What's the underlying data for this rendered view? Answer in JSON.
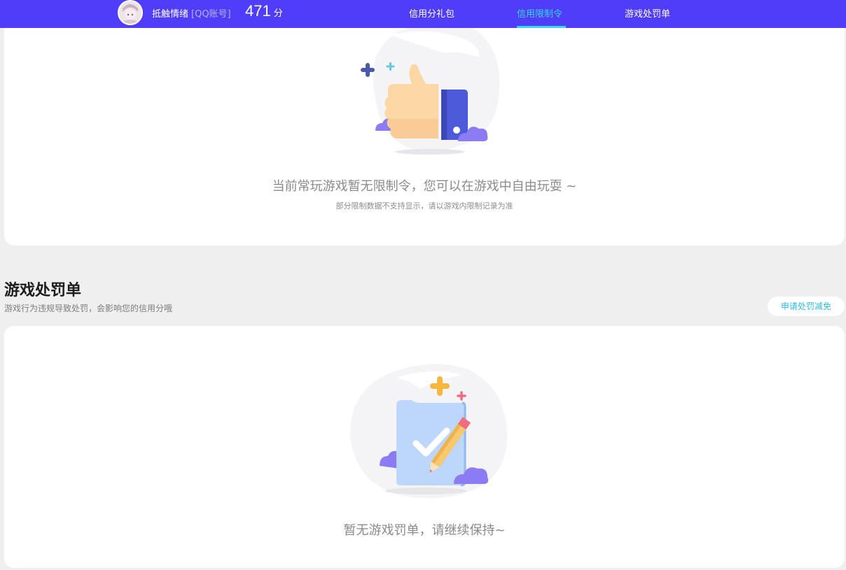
{
  "header": {
    "username": "抵触情绪",
    "account_tag": "[QQ账号]",
    "score": "471",
    "score_unit": "分",
    "nav": [
      {
        "label": "信用分礼包",
        "active": false
      },
      {
        "label": "信用限制令",
        "active": true
      },
      {
        "label": "游戏处罚单",
        "active": false
      }
    ]
  },
  "restriction_card": {
    "icon": "thumbs-up-illustration",
    "message": "当前常玩游戏暂无限制令，您可以在游戏中自由玩耍 ~",
    "note": "部分限制数据不支持显示，请以游戏内限制记录为准"
  },
  "penalty_section": {
    "title": "游戏处罚单",
    "description": "游戏行为违规导致处罚，会影响您的信用分哦",
    "appeal_button": "申请处罚减免"
  },
  "penalty_card": {
    "icon": "checked-document-illustration",
    "message": "暂无游戏罚单，请继续保持~"
  },
  "colors": {
    "header_bg": "#4f3dfa",
    "nav_active": "#35d8f4",
    "page_bg": "#efefef",
    "card_bg": "#ffffff",
    "accent_link": "#30b9de"
  }
}
